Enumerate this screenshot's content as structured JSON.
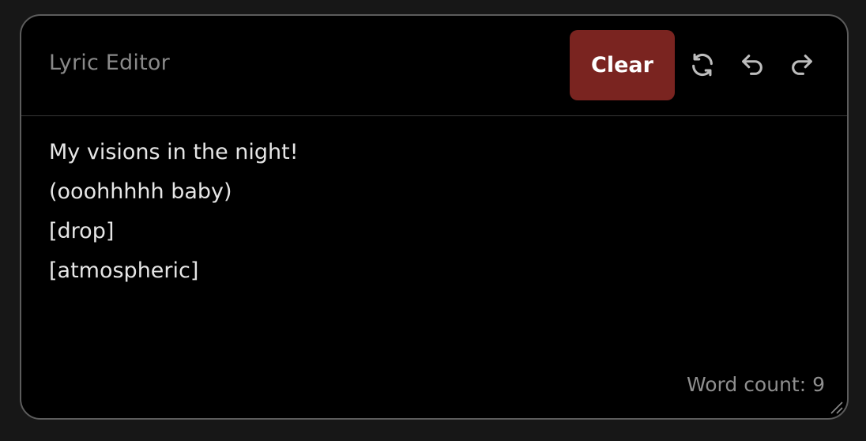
{
  "editor": {
    "title": "Lyric Editor",
    "clear_label": "Clear",
    "icons": {
      "refresh": "refresh-icon",
      "undo": "undo-icon",
      "redo": "redo-icon"
    },
    "lines": [
      "My visions in the night!",
      "(ooohhhhh baby)",
      "[drop]",
      "[atmospheric]"
    ],
    "word_count_text": "Word count: 9"
  },
  "colors": {
    "background": "#171717",
    "panel": "#000000",
    "clear_button": "#7a2420",
    "border": "#5c5c5c"
  }
}
